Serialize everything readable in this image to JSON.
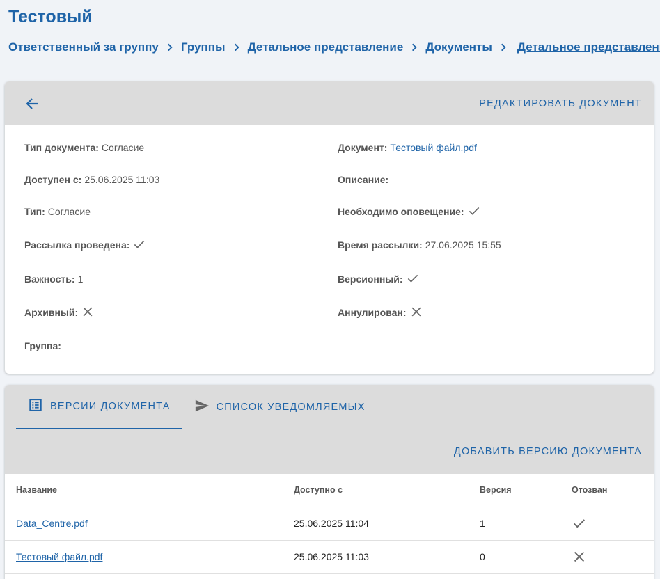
{
  "page": {
    "title": "Тестовый"
  },
  "breadcrumb": [
    "Ответственный за группу",
    "Группы",
    "Детальное представление",
    "Документы",
    "Детальное представление"
  ],
  "document_card": {
    "edit_label": "Редактировать документ",
    "fields": {
      "doc_type": {
        "label": "Тип документа:",
        "value": "Согласие"
      },
      "available_from": {
        "label": "Доступен с:",
        "value": "25.06.2025 11:03"
      },
      "type": {
        "label": "Тип:",
        "value": "Согласие"
      },
      "mailing_done": {
        "label": "Рассылка проведена:",
        "icon": "check-icon"
      },
      "importance": {
        "label": "Важность:",
        "value": "1"
      },
      "archived": {
        "label": "Архивный:",
        "icon": "close-icon"
      },
      "group": {
        "label": "Группа:",
        "value": ""
      },
      "document": {
        "label": "Документ:",
        "value": "Тестовый файл.pdf"
      },
      "description": {
        "label": "Описание:",
        "value": ""
      },
      "notify_required": {
        "label": "Необходимо оповещение:",
        "icon": "check-icon"
      },
      "mailing_time": {
        "label": "Время рассылки:",
        "value": "27.06.2025 15:55"
      },
      "versioned": {
        "label": "Версионный:",
        "icon": "check-icon"
      },
      "cancelled": {
        "label": "Аннулирован:",
        "icon": "close-icon"
      }
    }
  },
  "tabs": [
    {
      "label": "Версии документа",
      "icon": "list-icon",
      "active": true
    },
    {
      "label": "Список уведомляемых",
      "icon": "send-icon",
      "active": false
    }
  ],
  "add_version_label": "Добавить версию документа",
  "table": {
    "columns": [
      "Название",
      "Доступно с",
      "Версия",
      "Отозван"
    ],
    "rows": [
      {
        "name": "Data_Centre.pdf",
        "available": "25.06.2025 11:04",
        "version": "1",
        "revoked": "check-icon"
      },
      {
        "name": "Тестовый файл.pdf",
        "available": "25.06.2025 11:03",
        "version": "0",
        "revoked": "close-icon"
      }
    ]
  },
  "colors": {
    "accent": "#1f64a8",
    "background": "#f0f3f7",
    "header_bar": "#dcdcdc"
  }
}
